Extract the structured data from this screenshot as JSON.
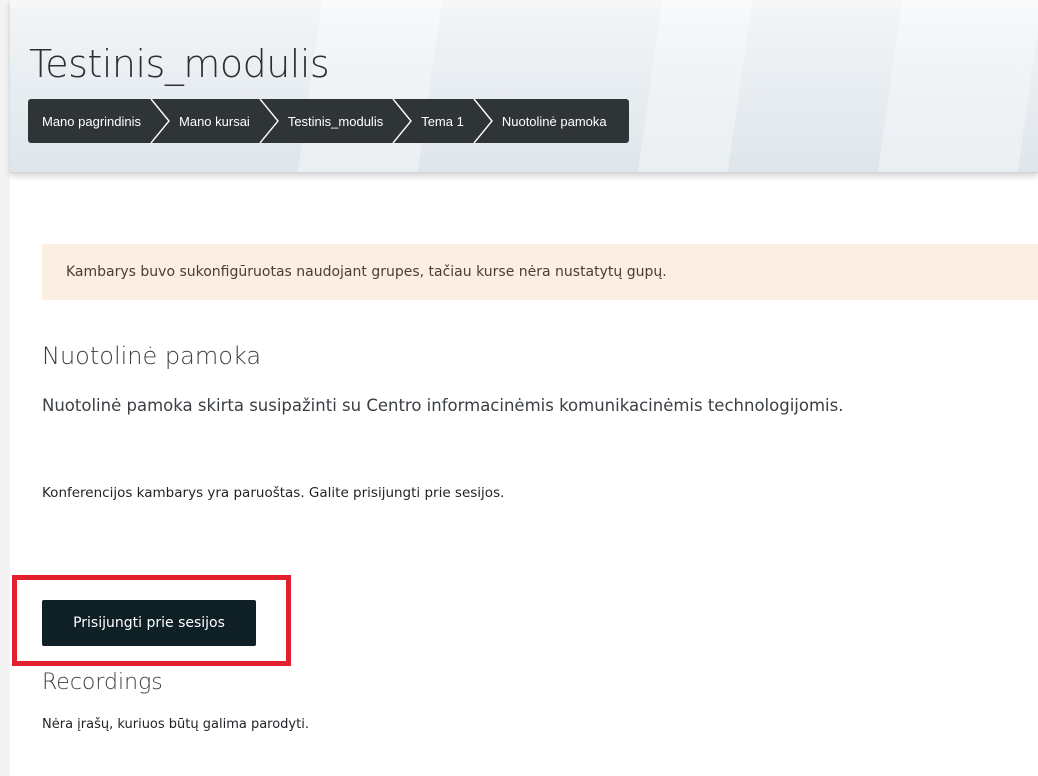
{
  "header": {
    "title": "Testinis_modulis",
    "breadcrumb": [
      {
        "label": "Mano pagrindinis"
      },
      {
        "label": "Mano kursai"
      },
      {
        "label": "Testinis_modulis"
      },
      {
        "label": "Tema 1"
      },
      {
        "label": "Nuotolinė pamoka"
      }
    ]
  },
  "alert": {
    "text": "Kambarys buvo sukonfigūruotas naudojant grupes, tačiau kurse nėra nustatytų gupų."
  },
  "activity": {
    "title": "Nuotolinė pamoka",
    "description": "Nuotolinė pamoka skirta susipažinti su Centro informacinėmis komunikacinėmis technologijomis.",
    "status": "Konferencijos kambarys yra paruoštas. Galite prisijungti prie sesijos.",
    "join_button_label": "Prisijungti prie sesijos"
  },
  "recordings": {
    "title": "Recordings",
    "empty_text": "Nėra įrašų, kuriuos būtų galima parodyti."
  },
  "colors": {
    "breadcrumb_bg": "#2f3437",
    "alert_bg": "#fbeee3",
    "button_bg": "#0f1f26",
    "highlight": "#e3202e"
  }
}
